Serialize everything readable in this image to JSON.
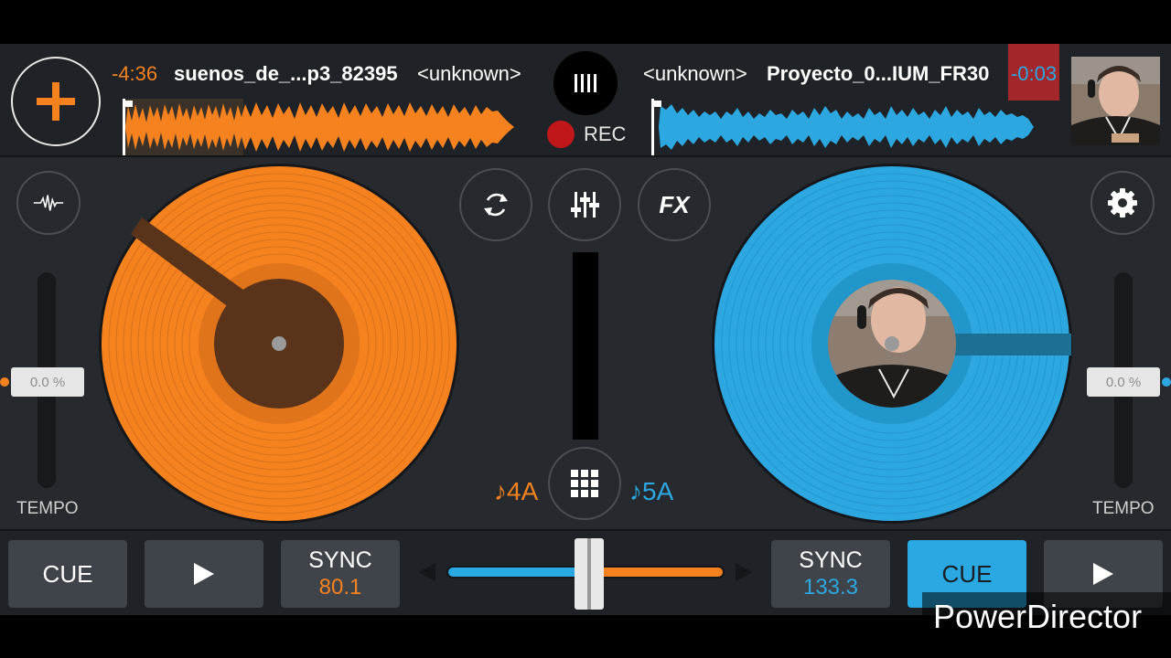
{
  "deck_left": {
    "time_remaining": "-4:36",
    "track_title": "suenos_de_...p3_82395",
    "artist": "<unknown>",
    "key": "♪4A",
    "tempo": "0.0 %",
    "tempo_label": "TEMPO",
    "cue_label": "CUE",
    "sync_label": "SYNC",
    "bpm": "80.1",
    "color": "#f5821f"
  },
  "deck_right": {
    "time_remaining": "-0:03",
    "track_title": "Proyecto_0...IUM_FR30",
    "artist": "<unknown>",
    "key": "♪5A",
    "tempo": "0.0 %",
    "tempo_label": "TEMPO",
    "cue_label": "CUE",
    "sync_label": "SYNC",
    "bpm": "133.3",
    "color": "#2ca7e0"
  },
  "header": {
    "rec_label": "REC",
    "add_icon": "plus-icon",
    "logo_icon": "bars-logo-icon"
  },
  "mixer": {
    "loop_icon": "loop-icon",
    "mixer_icon": "sliders-icon",
    "fx_label": "FX",
    "sampler_icon": "grid-icon",
    "crossfader_position": 0.5
  },
  "left_controls": {
    "waveform_icon": "waveform-icon"
  },
  "right_controls": {
    "settings_icon": "gear-icon"
  },
  "watermark": "PowerDirector"
}
